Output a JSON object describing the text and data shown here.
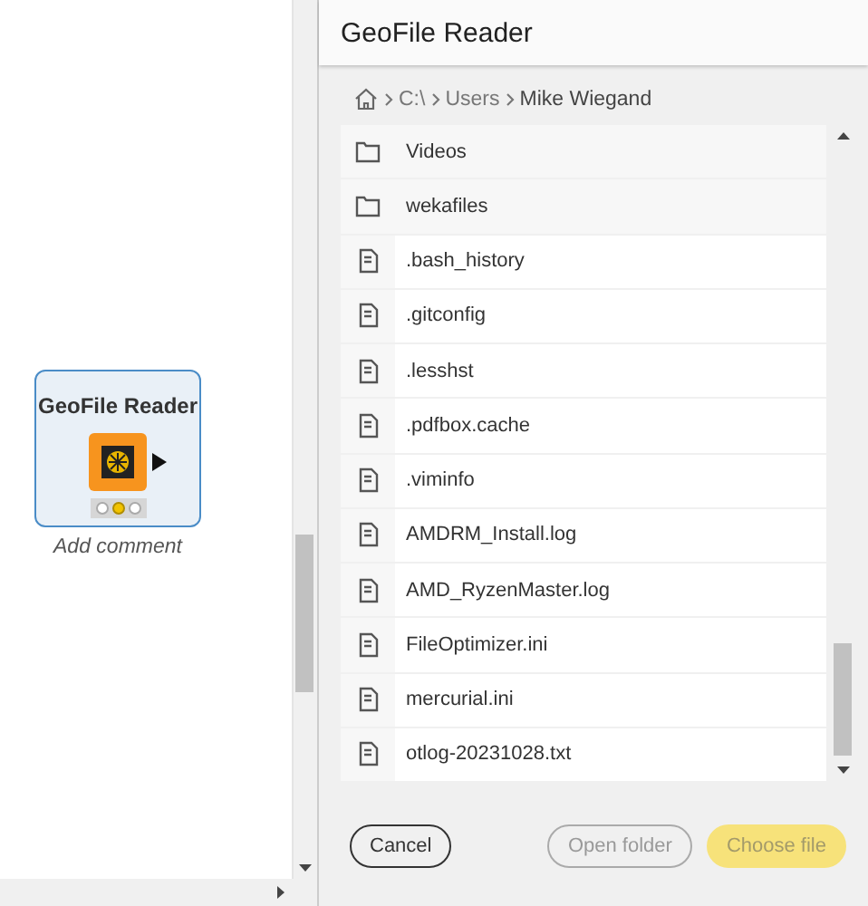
{
  "node": {
    "title": "GeoFile Reader",
    "comment": "Add comment",
    "status_dots": [
      {
        "on": false
      },
      {
        "on": true
      },
      {
        "on": false
      }
    ]
  },
  "dialog": {
    "title": "GeoFile Reader",
    "breadcrumb": [
      "C:\\",
      "Users",
      "Mike Wiegand"
    ],
    "items": [
      {
        "kind": "folder",
        "name": "Videos"
      },
      {
        "kind": "folder",
        "name": "wekafiles"
      },
      {
        "kind": "file",
        "name": ".bash_history"
      },
      {
        "kind": "file",
        "name": ".gitconfig"
      },
      {
        "kind": "file",
        "name": ".lesshst"
      },
      {
        "kind": "file",
        "name": ".pdfbox.cache"
      },
      {
        "kind": "file",
        "name": ".viminfo"
      },
      {
        "kind": "file",
        "name": "AMDRM_Install.log"
      },
      {
        "kind": "file",
        "name": "AMD_RyzenMaster.log"
      },
      {
        "kind": "file",
        "name": "FileOptimizer.ini"
      },
      {
        "kind": "file",
        "name": "mercurial.ini"
      },
      {
        "kind": "file",
        "name": "otlog-20231028.txt"
      }
    ],
    "buttons": [
      {
        "kind": "outline",
        "label": "Cancel",
        "disabled": false
      },
      {
        "kind": "outline",
        "label": "Open folder",
        "disabled": true
      },
      {
        "kind": "primary",
        "label": "Choose file",
        "disabled": true
      }
    ]
  }
}
